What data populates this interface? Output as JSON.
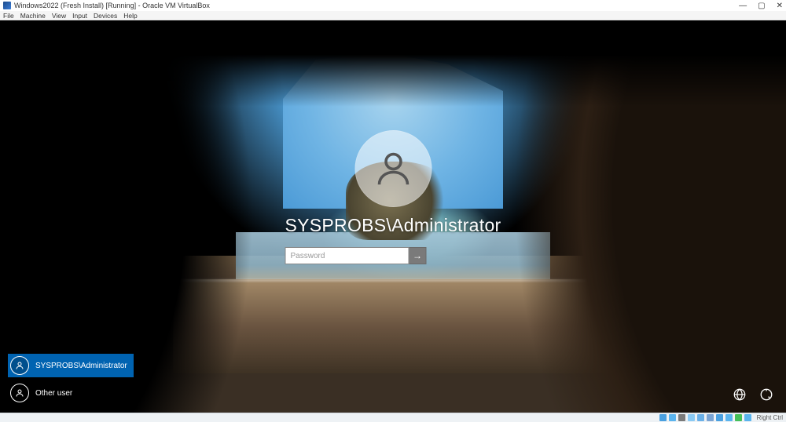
{
  "host": {
    "window_title": "Windows2022 (Fresh Install) [Running] - Oracle VM VirtualBox",
    "menu": [
      "File",
      "Machine",
      "View",
      "Input",
      "Devices",
      "Help"
    ],
    "controls": {
      "minimize": "—",
      "maximize": "▢",
      "close": "✕"
    }
  },
  "login": {
    "username": "SYSPROBS\\Administrator",
    "password_placeholder": "Password",
    "password_value": "",
    "submit_glyph": "→"
  },
  "user_list": [
    {
      "label": "SYSPROBS\\Administrator",
      "selected": true
    },
    {
      "label": "Other user",
      "selected": false
    }
  ],
  "login_utils": {
    "network_icon": "network-icon",
    "ease_icon": "ease-of-access-icon"
  },
  "vbox_status": {
    "indicator_label": "Right Ctrl"
  }
}
